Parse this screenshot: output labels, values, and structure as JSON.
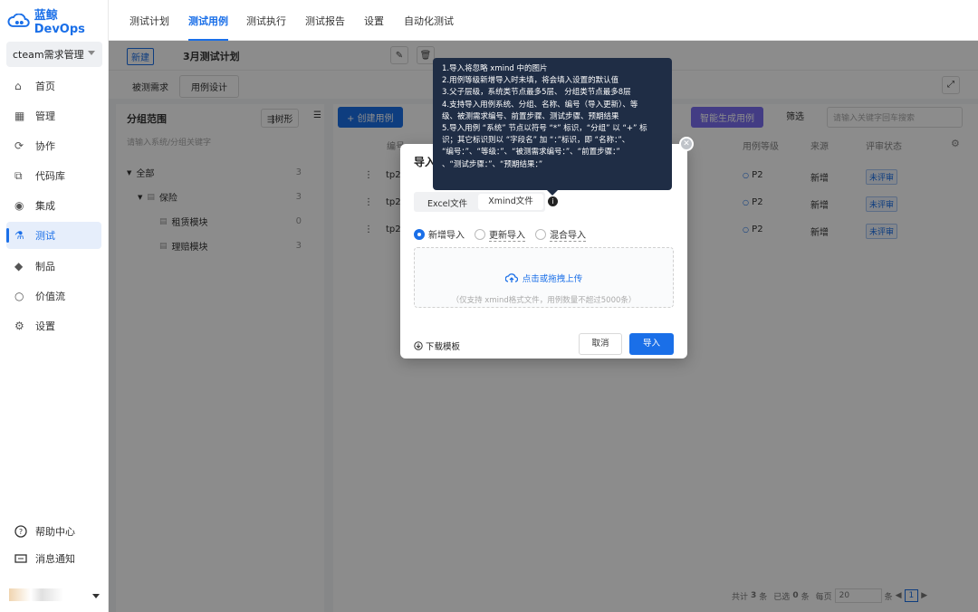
{
  "app": {
    "name": "蓝鲸DevOps",
    "project": "cteam需求管理"
  },
  "sidebar": {
    "items": [
      {
        "label": "首页",
        "icon": "home-icon"
      },
      {
        "label": "管理",
        "icon": "manage-icon"
      },
      {
        "label": "协作",
        "icon": "collab-icon"
      },
      {
        "label": "代码库",
        "icon": "code-icon"
      },
      {
        "label": "集成",
        "icon": "integration-icon"
      },
      {
        "label": "测试",
        "icon": "test-icon",
        "active": true
      },
      {
        "label": "制品",
        "icon": "artifact-icon"
      },
      {
        "label": "价值流",
        "icon": "valuestream-icon"
      },
      {
        "label": "设置",
        "icon": "settings-icon"
      }
    ],
    "help": "帮助中心",
    "notify": "消息通知"
  },
  "topnav": {
    "tabs": [
      "测试计划",
      "测试用例",
      "测试执行",
      "测试报告",
      "设置",
      "自动化测试"
    ],
    "active": 1
  },
  "plan": {
    "new_label": "新建",
    "name": "3月测试计划"
  },
  "subtabs": [
    "被测需求",
    "用例设计"
  ],
  "left": {
    "title": "分组范围",
    "tree_btn": "树形",
    "search_placeholder": "请输入系统/分组关键字",
    "tree": [
      {
        "label": "全部",
        "count": "3"
      },
      {
        "label": "保险",
        "count": "3"
      },
      {
        "label": "租赁模块",
        "count": "0"
      },
      {
        "label": "理赔模块",
        "count": "3"
      }
    ]
  },
  "toolbar": {
    "create": "+ 创建用例",
    "ai": "智能生成用例",
    "filter": "筛选",
    "search_placeholder": "请输入关键字回车搜索"
  },
  "table": {
    "headers": [
      "编号",
      "用例等级",
      "来源",
      "评审状态"
    ],
    "rows": [
      {
        "id": "tp2",
        "level": "P2",
        "source": "新增",
        "review": "未评审"
      },
      {
        "id": "tp2",
        "level": "P2",
        "source": "新增",
        "review": "未评审"
      },
      {
        "id": "tp2",
        "level": "P2",
        "source": "新增",
        "review": "未评审"
      }
    ]
  },
  "pagination": {
    "total_pre": "共计",
    "total": "3",
    "total_suf": "条",
    "sel_pre": "已选",
    "sel": "0",
    "sel_suf": "条",
    "per": "每页",
    "size": "20",
    "size_suf": "条",
    "page": "1"
  },
  "modal": {
    "title": "导入",
    "tabs": [
      "Excel文件",
      "Xmind文件"
    ],
    "active_tab": 1,
    "modes": [
      "新增导入",
      "更新导入",
      "混合导入"
    ],
    "upload_text": "点击或拖拽上传",
    "upload_hint": "（仅支持 xmind格式文件，用例数量不超过5000条）",
    "download": "下载模板",
    "cancel": "取消",
    "confirm": "导入"
  },
  "tooltip": [
    "1.导入将忽略 xmind 中的图片",
    "2.用例等级新增导入时未填，将会填入设置的默认值",
    "3.父子层级，系统类节点最多5层、 分组类节点最多8层",
    "4.支持导入用例系统、分组、名称、编号（导入更新）、等",
    "级、被测需求编号、前置步骤、测试步骤、预期结果",
    "5.导入用例 “系统” 节点以符号 “*” 标识，“分组” 以 “+” 标",
    "识；其它标识则以 “字段名” 加 “：”标识，即 “名称：”、",
    "“编号：”、“等级：”、“被测需求编号：”、“前置步骤：”",
    "、“测试步骤：”、“预期结果：”"
  ],
  "colors": {
    "primary": "#1a6fe8",
    "tooltip_bg": "#1f2d45"
  }
}
